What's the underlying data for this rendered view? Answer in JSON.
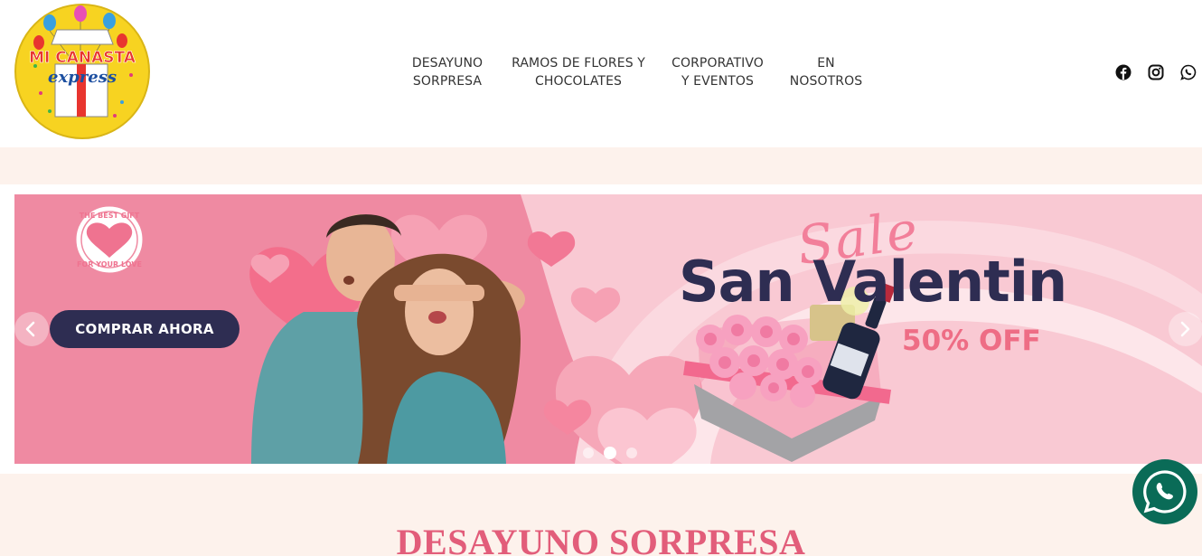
{
  "logo": {
    "line1": "MI CANASTA",
    "line2": "express"
  },
  "nav": {
    "items": [
      {
        "line1": "DESAYUNO",
        "line2": "SORPRESA"
      },
      {
        "line1": "RAMOS DE FLORES Y",
        "line2": "CHOCOLATES"
      },
      {
        "line1": "CORPORATIVO",
        "line2": "Y EVENTOS"
      },
      {
        "line1": "EN",
        "line2": "NOSOTROS"
      }
    ]
  },
  "social": {
    "icons": [
      "facebook-icon",
      "instagram-icon",
      "whatsapp-icon"
    ]
  },
  "slider": {
    "badge_top": "THE BEST GIFT",
    "badge_bottom": "FOR YOUR LOVE",
    "cta_label": "COMPRAR AHORA",
    "sale_script": "Sale",
    "sale_title": "San Valentin",
    "sale_discount": "50% OFF",
    "slide_count": 3,
    "active_slide": 2
  },
  "section": {
    "title": "DESAYUNO SORPRESA"
  },
  "colors": {
    "pink_bg": "#f08ca3",
    "navy": "#2e2d52",
    "accent_pink": "#ee6d85",
    "title_pink": "#e25d7a",
    "whatsapp_green": "#0a6b57",
    "page_bg": "#fdf2ec"
  }
}
